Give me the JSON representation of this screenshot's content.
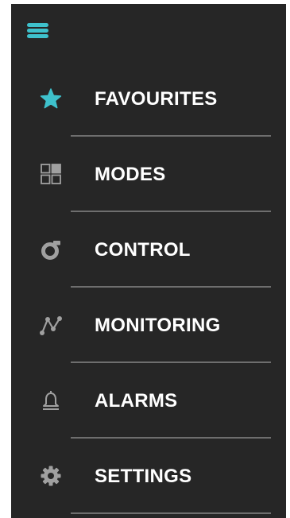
{
  "colors": {
    "panel_background": "#262626",
    "accent": "#3ec1cc",
    "icon_gray": "#a0a0a0",
    "label_text": "#ffffff",
    "divider": "#6e6e6e"
  },
  "header": {
    "menu_icon": "hamburger-icon"
  },
  "menu": {
    "items": [
      {
        "label": "FAVOURITES",
        "icon": "star-icon",
        "active": true
      },
      {
        "label": "MODES",
        "icon": "grid-icon",
        "active": false
      },
      {
        "label": "CONTROL",
        "icon": "dial-icon",
        "active": false
      },
      {
        "label": "MONITORING",
        "icon": "graph-icon",
        "active": false
      },
      {
        "label": "ALARMS",
        "icon": "bell-icon",
        "active": false
      },
      {
        "label": "SETTINGS",
        "icon": "gear-icon",
        "active": false
      }
    ]
  }
}
